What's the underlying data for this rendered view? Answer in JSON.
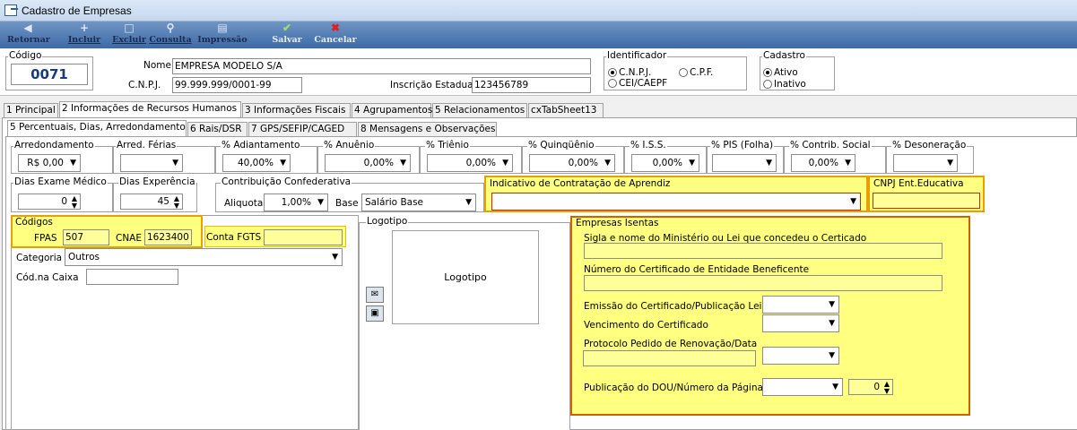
{
  "window": {
    "title": "Cadastro de Empresas"
  },
  "toolbar": {
    "retornar": "Retornar",
    "incluir": "Incluir",
    "excluir": "Excluir",
    "consulta": "Consulta",
    "impressao": "Impressão",
    "salvar": "Salvar",
    "cancelar": "Cancelar"
  },
  "header": {
    "codigo_label": "Código",
    "codigo": "0071",
    "nome_label": "Nome",
    "nome": "EMPRESA MODELO S/A",
    "cnpj_label": "C.N.P.J.",
    "cnpj": "99.999.999/0001-99",
    "ie_label": "Inscrição Estadual",
    "ie": "123456789",
    "identificador_label": "Identificador",
    "id_cnpj": "C.N.P.J.",
    "id_cpf": "C.P.F.",
    "id_cei": "CEI/CAEPF",
    "cadastro_label": "Cadastro",
    "ativo": "Ativo",
    "inativo": "Inativo"
  },
  "tabs": [
    "1 Principal",
    "2 Informações de Recursos Humanos",
    "3 Informações Fiscais",
    "4 Agrupamentos",
    "5 Relacionamentos",
    "cxTabSheet13"
  ],
  "subtabs": [
    "5 Percentuais, Dias, Arredondamento",
    "6 Rais/DSR",
    "7 GPS/SEFIP/CAGED",
    "8 Mensagens e Observações"
  ],
  "percentuais": {
    "arred_label": "Arredondamento",
    "arred": "R$ 0,00",
    "arred_ferias_label": "Arred. Férias",
    "arred_ferias": "",
    "adiant_label": "% Adiantamento",
    "adiant": "40,00%",
    "anuenio_label": "% Anuênio",
    "anuenio": "0,00%",
    "trienio_label": "% Triênio",
    "trienio": "0,00%",
    "quinq_label": "% Quinqüênio",
    "quinq": "0,00%",
    "iss_label": "% I.S.S.",
    "iss": "0,00%",
    "pis_label": "% PIS (Folha)",
    "pis": "",
    "contrib_label": "% Contrib. Social",
    "contrib": "0,00%",
    "deson_label": "% Desoneração",
    "deson": ""
  },
  "dias": {
    "exame_label": "Dias Exame Médico",
    "exame": "0",
    "exper_label": "Dias Experência",
    "exper": "45",
    "contrib_label": "Contribuição Confederativa",
    "aliquota_label": "Aliquota",
    "aliquota": "1,00%",
    "base_label": "Base",
    "base": "Salário Base",
    "aprendiz_label": "Indicativo de Contratação de Aprendiz",
    "aprendiz": "",
    "cnpj_edu_label": "CNPJ Ent.Educativa",
    "cnpj_edu": ""
  },
  "codigos": {
    "label": "Códigos",
    "fpas_label": "FPAS",
    "fpas": "507",
    "cnae_label": "CNAE",
    "cnae": "1623400",
    "fgts_label": "Conta FGTS",
    "fgts": "",
    "categoria_label": "Categoria",
    "categoria": "Outros",
    "caixa_label": "Cód.na Caixa",
    "caixa": ""
  },
  "logotipo": {
    "label": "Logotipo",
    "box": "Logotipo"
  },
  "isentas": {
    "label": "Empresas Isentas",
    "sigla_label": "Sigla e nome do Ministério ou Lei que concedeu o Certicado",
    "sigla": "",
    "numero_label": "Número do Certificado de Entidade Beneficente",
    "numero": "",
    "emissao_label": "Emissão do Certificado/Publicação Lei",
    "venc_label": "Vencimento do Certificado",
    "protocolo_label": "Protocolo Pedido de Renovação/Data",
    "dou_label": "Publicação do DOU/Número da Página",
    "pagina": "0"
  }
}
